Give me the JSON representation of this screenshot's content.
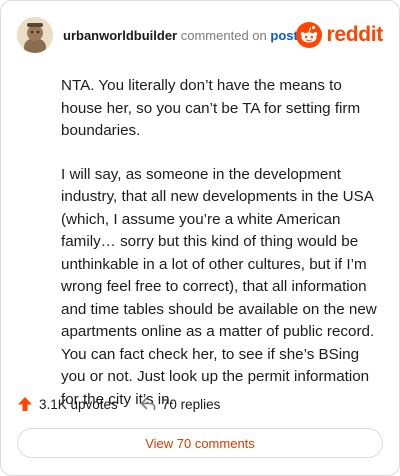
{
  "comment": {
    "username": "urbanworldbuilder",
    "action_text": "commented on",
    "post_link": "post",
    "paragraphs": [
      "NTA. You literally don’t have the means to house her, so you can’t be TA for setting firm boundaries.",
      "I will say, as someone in the development industry, that all new developments in the USA (which, I assume you’re a white American family… sorry but this kind of thing would be unthinkable in a lot of other cultures, but if I’m wrong feel free to correct), that all information and time tables should be available on the new apartments online as a matter of public record. You can fact check her, to see if she’s BSing you or not. Just look up the permit information for the city it’s in."
    ]
  },
  "brand": {
    "name": "reddit",
    "color": "#ff4500",
    "icon": "reddit-snoo-icon"
  },
  "stats": {
    "upvotes": "3.1K upvotes",
    "replies": "70 replies",
    "upvote_icon": "upvote-arrow-icon",
    "reply_icon": "reply-arrow-icon"
  },
  "footer": {
    "view_comments": "View 70 comments"
  },
  "colors": {
    "accent": "#d93a00",
    "link": "#0b5cc5",
    "upvote": "#ff4500"
  }
}
